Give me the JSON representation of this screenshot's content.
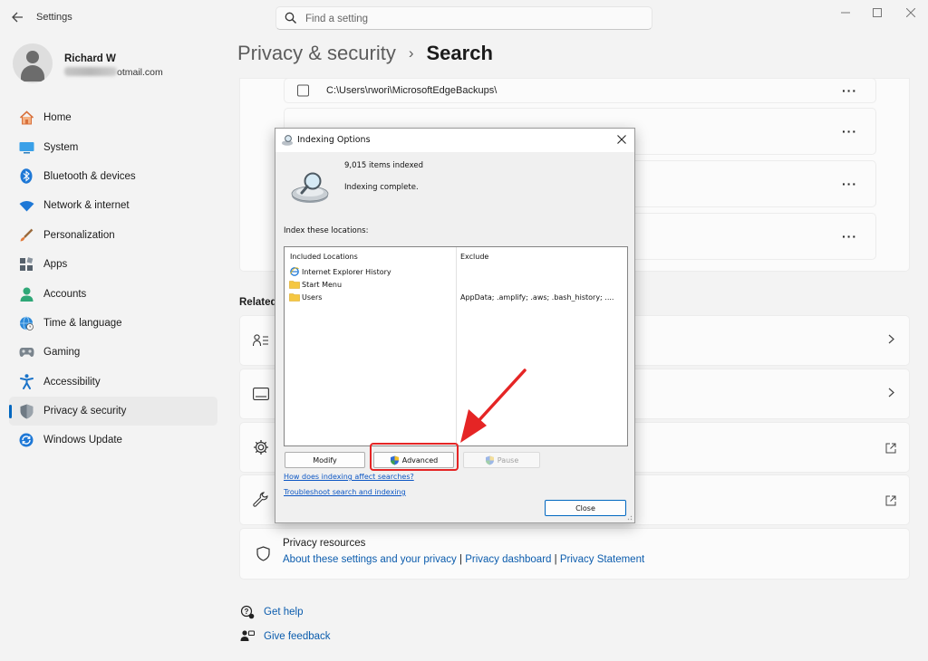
{
  "window": {
    "app_title": "Settings",
    "search_placeholder": "Find a setting"
  },
  "user": {
    "name": "Richard W",
    "email_suffix": "otmail.com"
  },
  "nav": [
    {
      "label": "Home",
      "icon": "home-icon"
    },
    {
      "label": "System",
      "icon": "display-icon"
    },
    {
      "label": "Bluetooth & devices",
      "icon": "bluetooth-icon"
    },
    {
      "label": "Network & internet",
      "icon": "wifi-icon"
    },
    {
      "label": "Personalization",
      "icon": "brush-icon"
    },
    {
      "label": "Apps",
      "icon": "apps-icon"
    },
    {
      "label": "Accounts",
      "icon": "person-icon"
    },
    {
      "label": "Time & language",
      "icon": "globe-clock-icon"
    },
    {
      "label": "Gaming",
      "icon": "gamepad-icon"
    },
    {
      "label": "Accessibility",
      "icon": "accessibility-icon"
    },
    {
      "label": "Privacy & security",
      "icon": "shield-icon",
      "active": true
    },
    {
      "label": "Windows Update",
      "icon": "update-icon"
    }
  ],
  "header": {
    "parent": "Privacy & security",
    "separator": "›",
    "current": "Search"
  },
  "excluded_folders": {
    "first_path": "C:\\Users\\rwori\\MicrosoftEdgeBackups\\",
    "more_label": "···"
  },
  "related": {
    "section_label": "Related"
  },
  "privacy_resources": {
    "title": "Privacy resources",
    "link1": "About these settings and your privacy",
    "sep1": "|",
    "link2": "Privacy dashboard",
    "sep2": "|",
    "link3": "Privacy Statement"
  },
  "footer": {
    "get_help": "Get help",
    "give_feedback": "Give feedback"
  },
  "dialog": {
    "title": "Indexing Options",
    "items_indexed": "9,015 items indexed",
    "status": "Indexing complete.",
    "index_label": "Index these locations:",
    "col_included": "Included Locations",
    "col_exclude": "Exclude",
    "locations": [
      {
        "name": "Internet Explorer History",
        "exclude": ""
      },
      {
        "name": "Start Menu",
        "exclude": ""
      },
      {
        "name": "Users",
        "exclude": "AppData; .amplify; .aws; .bash_history; ...."
      }
    ],
    "modify": "Modify",
    "advanced": "Advanced",
    "pause": "Pause",
    "link_how": "How does indexing affect searches?",
    "link_troubleshoot": "Troubleshoot search and indexing",
    "close": "Close"
  },
  "colors": {
    "accent": "#0067c0",
    "link": "#0b5cad",
    "annotation_red": "#e52525"
  }
}
